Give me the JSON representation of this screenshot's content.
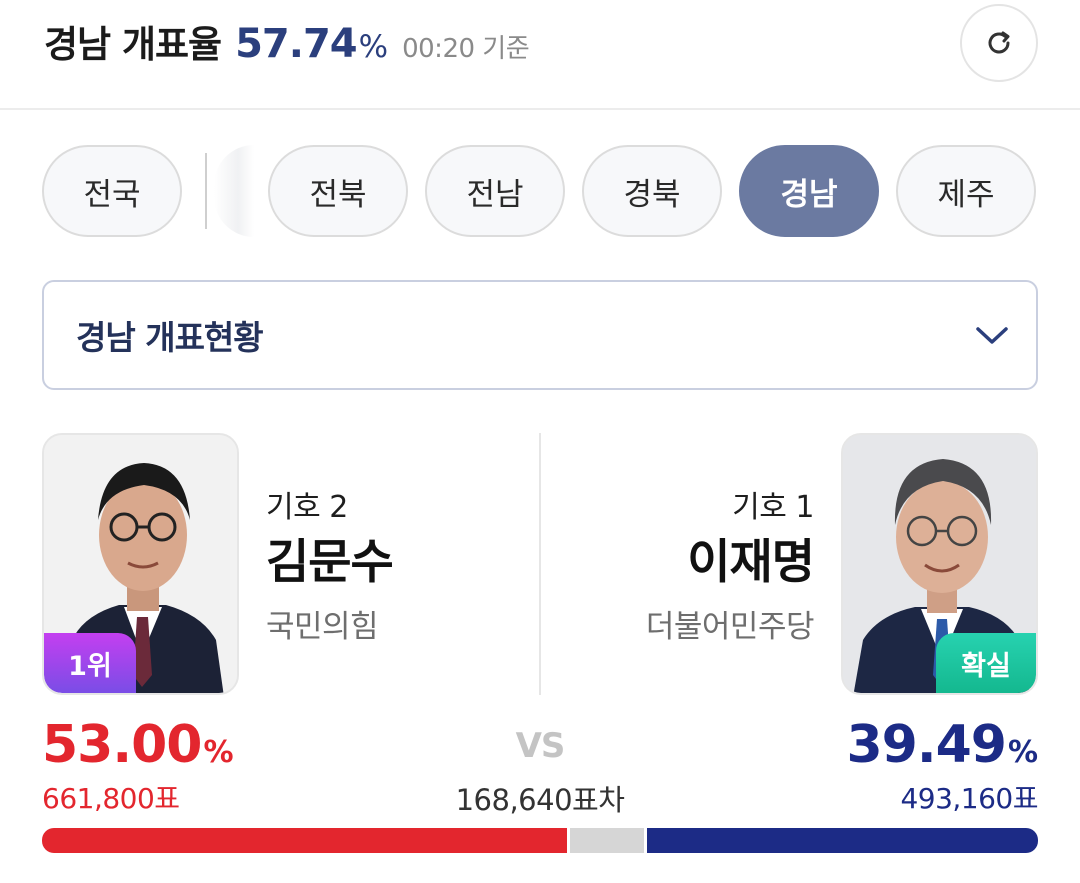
{
  "header": {
    "title": "경남 개표율",
    "rate": "57.74",
    "rate_unit": "%",
    "time": "00:20 기준"
  },
  "tabs": [
    {
      "label": "전국",
      "active": false
    },
    {
      "label": "전북",
      "active": false
    },
    {
      "label": "전남",
      "active": false
    },
    {
      "label": "경북",
      "active": false
    },
    {
      "label": "경남",
      "active": true
    },
    {
      "label": "제주",
      "active": false
    }
  ],
  "dropdown": {
    "label": "경남 개표현황"
  },
  "candidates": {
    "left": {
      "number": "기호 2",
      "name": "김문수",
      "party": "국민의힘",
      "badge": "1위",
      "percent": "53.00",
      "percent_unit": "%",
      "votes": "661,800표",
      "color": "#e3262e",
      "share": 53.0
    },
    "right": {
      "number": "기호 1",
      "name": "이재명",
      "party": "더불어민주당",
      "badge": "확실",
      "percent": "39.49",
      "percent_unit": "%",
      "votes": "493,160표",
      "color": "#1c2b86",
      "share": 39.49
    }
  },
  "versus": {
    "vs_label": "VS",
    "difference": "168,640표차"
  },
  "colors": {
    "accent": "#2b3f7d",
    "active_tab": "#6b7aa1",
    "red": "#e3262e",
    "blue": "#1c2b86",
    "confirm": "#14b88f"
  },
  "icons": {
    "refresh": "refresh-icon",
    "dropdown": "chevron-down-icon"
  }
}
